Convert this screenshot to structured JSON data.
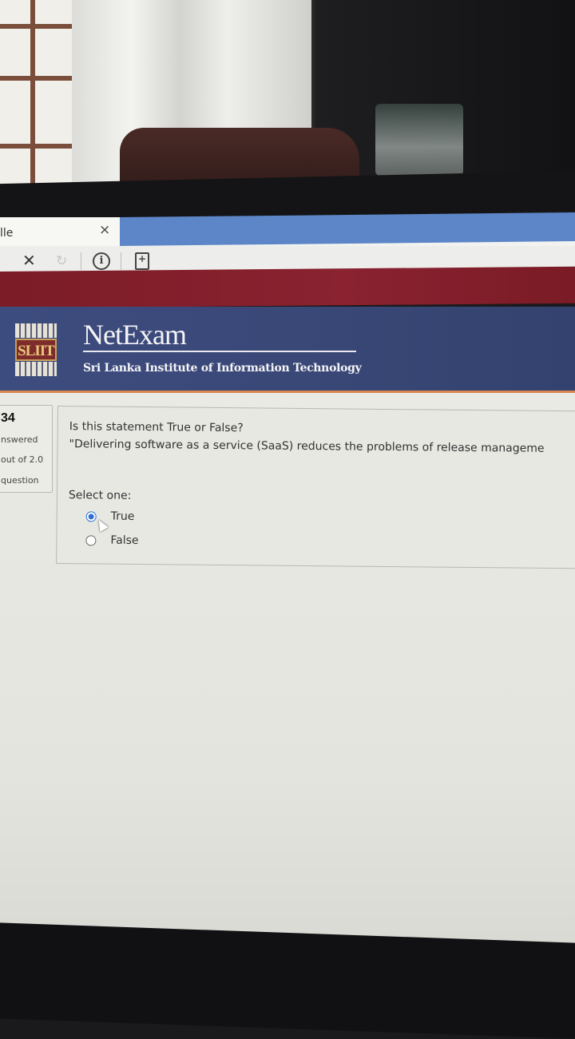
{
  "browser": {
    "tab_title": "lle",
    "tab_close_glyph": "×",
    "nav_close_glyph": "✕",
    "nav_reload_glyph": "↻"
  },
  "header": {
    "brand": "NetExam",
    "subtitle": "Sri Lanka Institute of Information Technology",
    "logo_text": "SLIIT"
  },
  "question_info": {
    "number": "34",
    "status": "nswered",
    "marks": "out of 2.0",
    "flag": "question"
  },
  "question": {
    "line1": "Is this statement True or False?",
    "line2": "\"Delivering software as a service (SaaS) reduces the problems of release manageme",
    "prompt": "Select one:",
    "options": [
      {
        "label": "True",
        "selected": true
      },
      {
        "label": "False",
        "selected": false
      }
    ]
  },
  "colors": {
    "banner": "#3d4c7e",
    "maroon_strip": "#7b1c26",
    "tab_blue": "#5c86c8",
    "radio_selected": "#2d6fd6"
  }
}
